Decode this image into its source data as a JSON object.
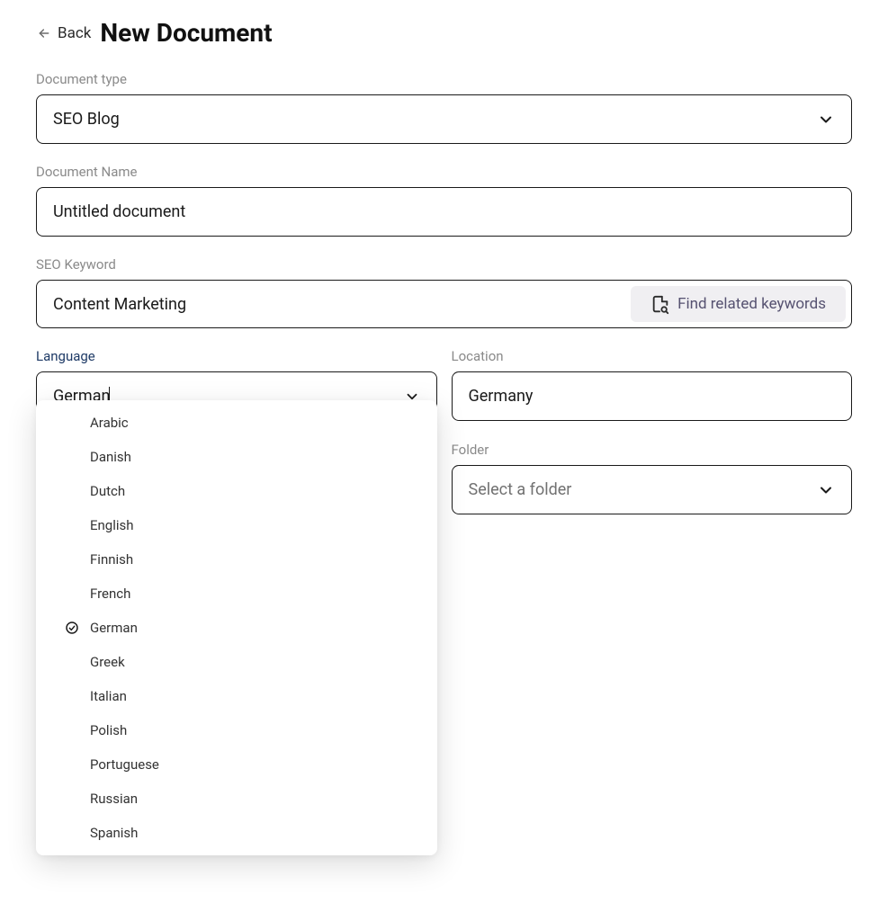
{
  "header": {
    "back_label": "Back",
    "title": "New Document"
  },
  "fields": {
    "document_type": {
      "label": "Document type",
      "value": "SEO Blog"
    },
    "document_name": {
      "label": "Document Name",
      "value": "Untitled document"
    },
    "seo_keyword": {
      "label": "SEO Keyword",
      "value": "Content Marketing",
      "find_label": "Find related keywords"
    },
    "language": {
      "label": "Language",
      "value": "German"
    },
    "location": {
      "label": "Location",
      "value": "Germany"
    },
    "folder": {
      "label": "Folder",
      "placeholder": "Select a folder"
    }
  },
  "language_options": [
    {
      "label": "Arabic",
      "selected": false
    },
    {
      "label": "Danish",
      "selected": false
    },
    {
      "label": "Dutch",
      "selected": false
    },
    {
      "label": "English",
      "selected": false
    },
    {
      "label": "Finnish",
      "selected": false
    },
    {
      "label": "French",
      "selected": false
    },
    {
      "label": "German",
      "selected": true
    },
    {
      "label": "Greek",
      "selected": false
    },
    {
      "label": "Italian",
      "selected": false
    },
    {
      "label": "Polish",
      "selected": false
    },
    {
      "label": "Portuguese",
      "selected": false
    },
    {
      "label": "Russian",
      "selected": false
    },
    {
      "label": "Spanish",
      "selected": false
    }
  ]
}
